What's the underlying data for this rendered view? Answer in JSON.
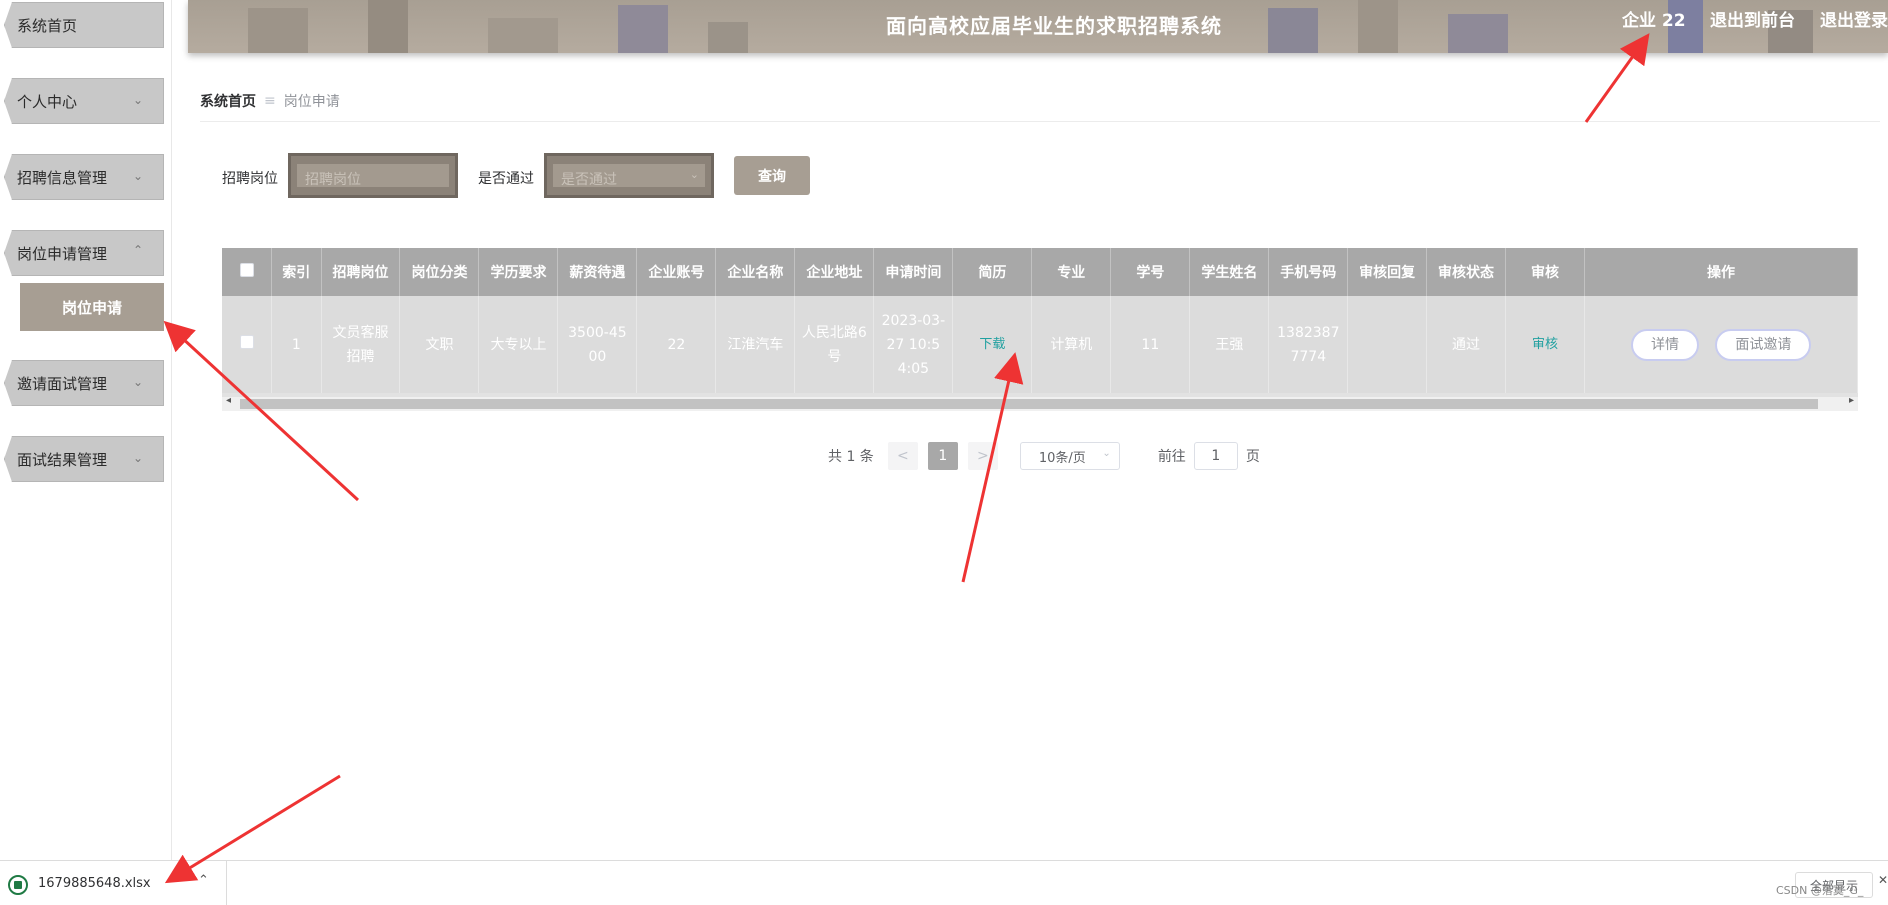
{
  "header": {
    "title": "面向高校应届毕业生的求职招聘系统",
    "user": "企业 22",
    "front": "退出到前台",
    "logout": "退出登录"
  },
  "sidebar": {
    "items": [
      {
        "label": "系统首页"
      },
      {
        "label": "个人中心"
      },
      {
        "label": "招聘信息管理"
      },
      {
        "label": "岗位申请管理"
      },
      {
        "label": "邀请面试管理"
      },
      {
        "label": "面试结果管理"
      }
    ],
    "sub_active": "岗位申请"
  },
  "breadcrumb": {
    "home": "系统首页",
    "current": "岗位申请"
  },
  "search": {
    "job_label": "招聘岗位",
    "job_placeholder": "招聘岗位",
    "pass_label": "是否通过",
    "pass_placeholder": "是否通过",
    "query_button": "查询"
  },
  "table": {
    "headers": [
      "索引",
      "招聘岗位",
      "岗位分类",
      "学历要求",
      "薪资待遇",
      "企业账号",
      "企业名称",
      "企业地址",
      "申请时间",
      "简历",
      "专业",
      "学号",
      "学生姓名",
      "手机号码",
      "审核回复",
      "审核状态",
      "审核",
      "操作"
    ],
    "rows": [
      {
        "index": "1",
        "job": "文员客服招聘",
        "category": "文职",
        "education": "大专以上",
        "salary": "3500-4500",
        "company_account": "22",
        "company_name": "江淮汽车",
        "company_address": "人民北路6号",
        "apply_time": "2023-03-27 10:54:05",
        "resume": "下载",
        "major": "计算机",
        "student_id": "11",
        "student_name": "王强",
        "phone": "13823877774",
        "reply": "",
        "status": "通过",
        "review": "审核",
        "detail": "详情",
        "invite": "面试邀请"
      }
    ]
  },
  "pagination": {
    "total": "共 1 条",
    "prev": "<",
    "page": "1",
    "next": ">",
    "page_size": "10条/页",
    "goto_prefix": "前往",
    "goto_value": "1",
    "goto_suffix": "页"
  },
  "download_bar": {
    "file_name": "1679885648.xlsx",
    "show_all": "全部显示",
    "watermark": "CSDN @落寞_G_"
  },
  "colors": {
    "accent": "#a79e93",
    "header_bg": "#a89f93",
    "table_header": "#a8a8a8",
    "link": "#20a0a0",
    "annotation_arrow": "#ee3333"
  }
}
